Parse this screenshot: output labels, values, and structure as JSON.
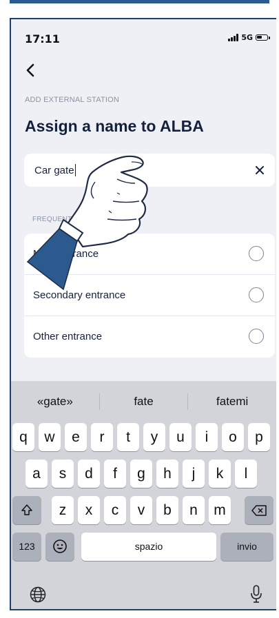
{
  "status_bar": {
    "time": "17:11",
    "network": "5G"
  },
  "header": {
    "kicker": "ADD EXTERNAL STATION",
    "title": "Assign a name to ALBA"
  },
  "name_input": {
    "value": "Car gate"
  },
  "frequent": {
    "label": "FREQUENT",
    "items": [
      {
        "label": "Main entrance"
      },
      {
        "label": "Secondary entrance"
      },
      {
        "label": "Other entrance"
      }
    ]
  },
  "keyboard": {
    "suggestions": [
      "«gate»",
      "fate",
      "fatemi"
    ],
    "row1": [
      "q",
      "w",
      "e",
      "r",
      "t",
      "y",
      "u",
      "i",
      "o",
      "p"
    ],
    "row2": [
      "a",
      "s",
      "d",
      "f",
      "g",
      "h",
      "j",
      "k",
      "l"
    ],
    "row3": [
      "z",
      "x",
      "c",
      "v",
      "b",
      "n",
      "m"
    ],
    "numbers_key": "123",
    "space_key": "spazio",
    "return_key": "invio"
  }
}
